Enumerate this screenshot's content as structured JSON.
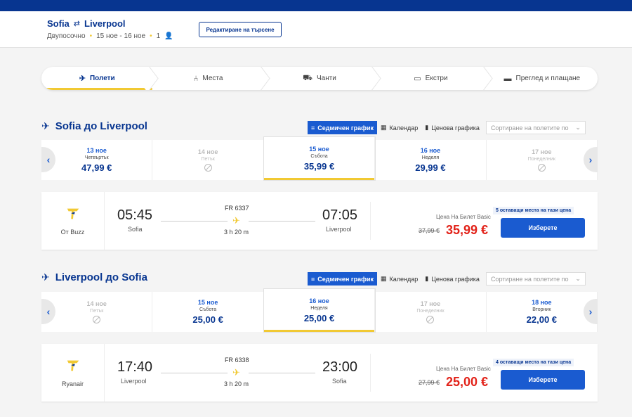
{
  "topbar": {
    "right_text": ""
  },
  "search": {
    "origin": "Sofia",
    "destination": "Liverpool",
    "swap_icon": "swap-arrows-icon",
    "trip_type": "Двупосочно",
    "dates": "15 ное - 16 ное",
    "passengers": "1",
    "edit_label": "Редактиране на търсене"
  },
  "steps": [
    {
      "label": "Полети",
      "icon": "✈"
    },
    {
      "label": "Места",
      "icon": "⛾"
    },
    {
      "label": "Чанти",
      "icon": "⛶"
    },
    {
      "label": "Екстри",
      "icon": "▭"
    },
    {
      "label": "Преглед и плащане",
      "icon": "▬"
    }
  ],
  "tools": {
    "weekly": "Седмичен график",
    "calendar": "Календар",
    "price_chart": "Ценова графика",
    "sort_placeholder": "Сортиране на полетите по"
  },
  "outbound": {
    "title": "Sofia до Liverpool",
    "dates": [
      {
        "date": "13 ное",
        "weekday": "Четвъртък",
        "price": "47,99 €",
        "available": true
      },
      {
        "date": "14 ное",
        "weekday": "Петък",
        "price": "",
        "available": false
      },
      {
        "date": "15 ное",
        "weekday": "Събота",
        "price": "35,99 €",
        "available": true,
        "selected": true
      },
      {
        "date": "16 ное",
        "weekday": "Неделя",
        "price": "29,99 €",
        "available": true
      },
      {
        "date": "17 ное",
        "weekday": "Понеделник",
        "price": "",
        "available": false
      }
    ],
    "flight": {
      "airline": "От Buzz",
      "depart_time": "05:45",
      "depart_city": "Sofia",
      "flight_number": "FR 6337",
      "duration": "3 h 20 m",
      "arrive_time": "07:05",
      "arrive_city": "Liverpool",
      "seats_left": "5 оставащи места на тази цена",
      "fare_label": "Цена На Билет Basic",
      "old_price": "37,99 €",
      "price": "35,99 €",
      "select_label": "Изберете"
    }
  },
  "inbound": {
    "title": "Liverpool до Sofia",
    "dates": [
      {
        "date": "14 ное",
        "weekday": "Петък",
        "price": "",
        "available": false
      },
      {
        "date": "15 ное",
        "weekday": "Събота",
        "price": "25,00 €",
        "available": true
      },
      {
        "date": "16 ное",
        "weekday": "Неделя",
        "price": "25,00 €",
        "available": true,
        "selected": true
      },
      {
        "date": "17 ное",
        "weekday": "Понеделник",
        "price": "",
        "available": false
      },
      {
        "date": "18 ное",
        "weekday": "Вторник",
        "price": "22,00 €",
        "available": true
      }
    ],
    "flight": {
      "airline": "Ryanair",
      "depart_time": "17:40",
      "depart_city": "Liverpool",
      "flight_number": "FR 6338",
      "duration": "3 h 20 m",
      "arrive_time": "23:00",
      "arrive_city": "Sofia",
      "seats_left": "4 оставащи места на тази цена",
      "fare_label": "Цена На Билет Basic",
      "old_price": "27,99 €",
      "price": "25,00 €",
      "select_label": "Изберете"
    }
  },
  "colors": {
    "brand_blue": "#073590",
    "accent_yellow": "#f1c933",
    "price_red": "#e2231a",
    "button_blue": "#1a5bd0"
  }
}
